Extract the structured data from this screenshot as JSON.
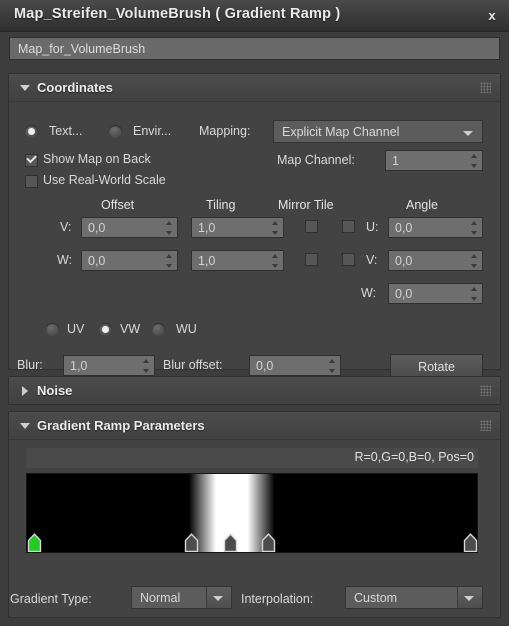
{
  "window": {
    "title": "Map_Streifen_VolumeBrush  ( Gradient Ramp )",
    "close_label": "x",
    "map_name": "Map_for_VolumeBrush"
  },
  "coordinates": {
    "title": "Coordinates",
    "texture_label": "Text...",
    "environ_label": "Envir...",
    "texture_selected": true,
    "mapping_label": "Mapping:",
    "mapping_value": "Explicit Map Channel",
    "show_map_on_back_label": "Show Map on Back",
    "show_map_on_back_checked": true,
    "use_real_world_scale_label": "Use Real-World Scale",
    "use_real_world_scale_checked": false,
    "map_channel_label": "Map Channel:",
    "map_channel_value": "1",
    "col_offset": "Offset",
    "col_tiling": "Tiling",
    "col_mirror_tile": "Mirror Tile",
    "col_angle": "Angle",
    "rows": [
      {
        "axis": "V:",
        "offset": "0,0",
        "tiling": "1,0",
        "mirror": false,
        "tile": false
      },
      {
        "axis": "W:",
        "offset": "0,0",
        "tiling": "1,0",
        "mirror": false,
        "tile": false
      }
    ],
    "angle": [
      {
        "axis": "U:",
        "value": "0,0"
      },
      {
        "axis": "V:",
        "value": "0,0"
      },
      {
        "axis": "W:",
        "value": "0,0"
      }
    ],
    "axis_modes": [
      {
        "label": "UV",
        "selected": false
      },
      {
        "label": "VW",
        "selected": true
      },
      {
        "label": "WU",
        "selected": false
      }
    ],
    "blur_label": "Blur:",
    "blur_value": "1,0",
    "blur_offset_label": "Blur offset:",
    "blur_offset_value": "0,0",
    "rotate_label": "Rotate"
  },
  "noise": {
    "title": "Noise"
  },
  "gradient_ramp": {
    "title": "Gradient Ramp Parameters",
    "readout": "R=0,G=0,B=0, Pos=0",
    "gradient_type_label": "Gradient Type:",
    "gradient_type_value": "Normal",
    "interpolation_label": "Interpolation:",
    "interpolation_value": "Custom",
    "ramp_stops": [
      {
        "pos": 0,
        "color": "#000000"
      },
      {
        "pos": 36,
        "color": "#000000"
      },
      {
        "pos": 42,
        "color": "#ffffff"
      },
      {
        "pos": 49,
        "color": "#ffffff"
      },
      {
        "pos": 55,
        "color": "#000000"
      },
      {
        "pos": 100,
        "color": "#000000"
      }
    ],
    "flags": [
      {
        "pos": 0,
        "color": "#22cc22",
        "selected": true
      },
      {
        "pos": 36.5,
        "color": "#4c4c4c",
        "selected": false
      },
      {
        "pos": 45.0,
        "color": "#4c4c4c",
        "selected": false
      },
      {
        "pos": 53.5,
        "color": "#4c4c4c",
        "selected": false
      },
      {
        "pos": 99.0,
        "color": "#4c4c4c",
        "selected": false
      }
    ]
  }
}
